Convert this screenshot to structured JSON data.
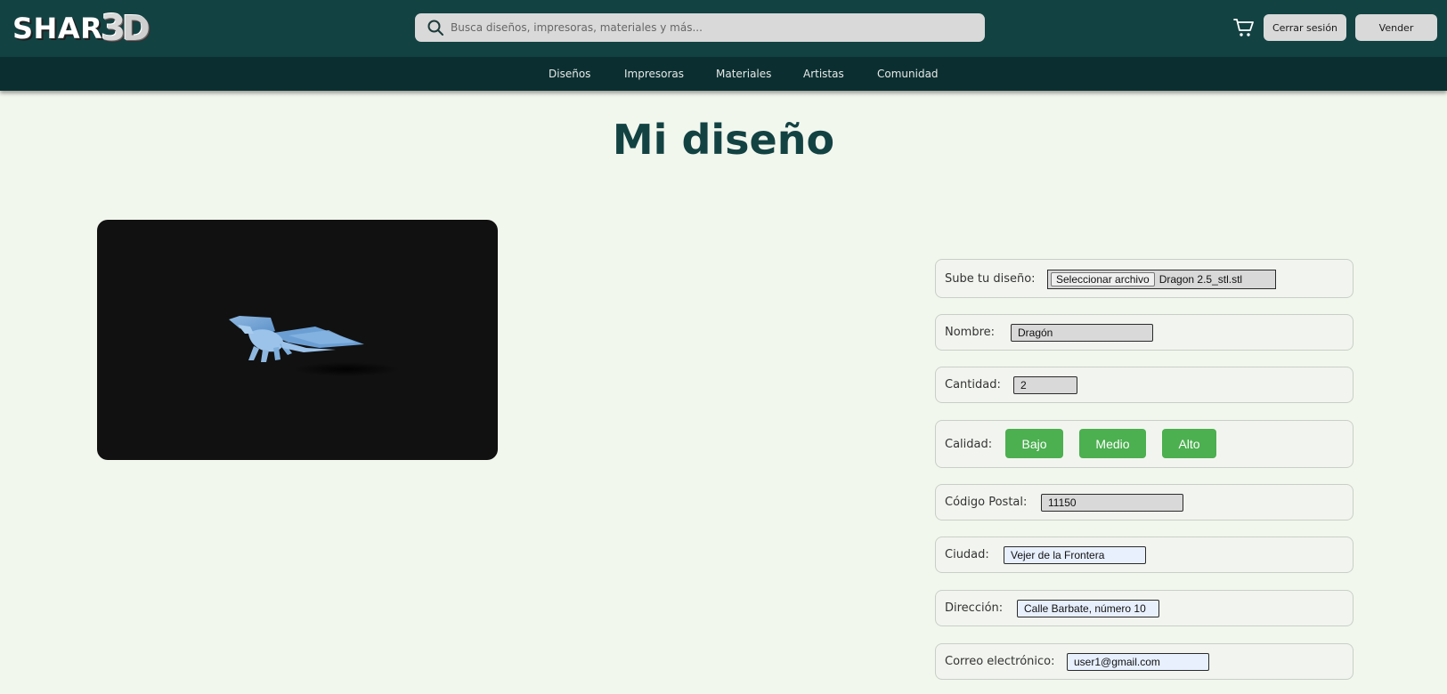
{
  "header": {
    "logo": {
      "part1": "SHAR",
      "part2": "3",
      "part3": "D"
    },
    "search": {
      "placeholder": "Busca diseños, impresoras, materiales y más...",
      "icon": "search-icon"
    },
    "cart_icon": "cart-icon",
    "logout_label": "Cerrar sesión",
    "sell_label": "Vender"
  },
  "nav": {
    "items": [
      "Diseños",
      "Impresoras",
      "Materiales",
      "Artistas",
      "Comunidad"
    ]
  },
  "page": {
    "title": "Mi diseño"
  },
  "viewer": {
    "model": "dragon"
  },
  "form": {
    "upload": {
      "label": "Sube tu diseño:",
      "button": "Seleccionar archivo",
      "file_name": "Dragon 2.5_stl.stl"
    },
    "name": {
      "label": "Nombre:",
      "value": "Dragón"
    },
    "quantity": {
      "label": "Cantidad:",
      "value": "2"
    },
    "quality": {
      "label": "Calidad:",
      "options": [
        "Bajo",
        "Medio",
        "Alto"
      ]
    },
    "postal_code": {
      "label": "Código Postal:",
      "value": "11150"
    },
    "city": {
      "label": "Ciudad:",
      "value": "Vejer de la Frontera"
    },
    "address": {
      "label": "Dirección:",
      "value": "Calle Barbate, número 10"
    },
    "email": {
      "label": "Correo electrónico:",
      "value": "user1@gmail.com"
    }
  },
  "colors": {
    "header_bg": "#134243",
    "nav_bg": "#0b2f30",
    "page_bg": "#f2f7ee",
    "accent_green": "#4caf50"
  }
}
